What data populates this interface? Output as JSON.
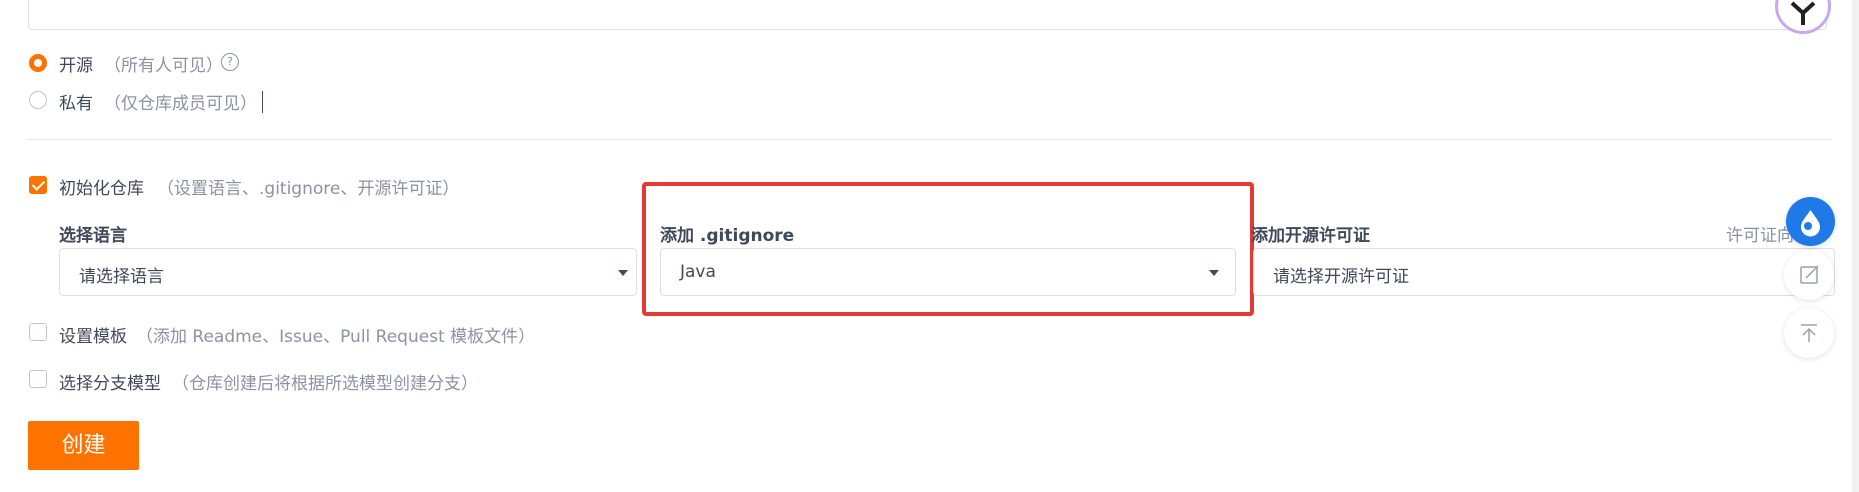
{
  "visibility": {
    "public": {
      "label": "开源",
      "hint": "（所有人可见）",
      "checked": true
    },
    "private": {
      "label": "私有",
      "hint": "（仅仓库成员可见）",
      "checked": false
    },
    "help_icon_text": "?"
  },
  "init_repo": {
    "label": "初始化仓库",
    "hint": "（设置语言、.gitignore、开源许可证）",
    "checked": true,
    "language": {
      "title": "选择语言",
      "value": "请选择语言"
    },
    "gitignore": {
      "title": "添加 .gitignore",
      "value": "Java"
    },
    "license": {
      "title": "添加开源许可证",
      "value": "请选择开源许可证",
      "link_partial": "许可证向"
    }
  },
  "template": {
    "label": "设置模板",
    "hint": "（添加 Readme、Issue、Pull Request 模板文件）",
    "checked": false
  },
  "branch_model": {
    "label": "选择分支模型",
    "hint": "（仓库创建后将根据所选模型创建分支）",
    "checked": false
  },
  "create_button": {
    "label": "创建"
  },
  "colors": {
    "accent": "#fe7300",
    "highlight": "#e53935",
    "text": "#40485b",
    "muted": "#8c92a4"
  },
  "icons": [
    "help-icon",
    "dropdown-caret-icon",
    "avatar-logo-icon",
    "water-drop-icon",
    "edit-icon",
    "back-to-top-icon"
  ]
}
